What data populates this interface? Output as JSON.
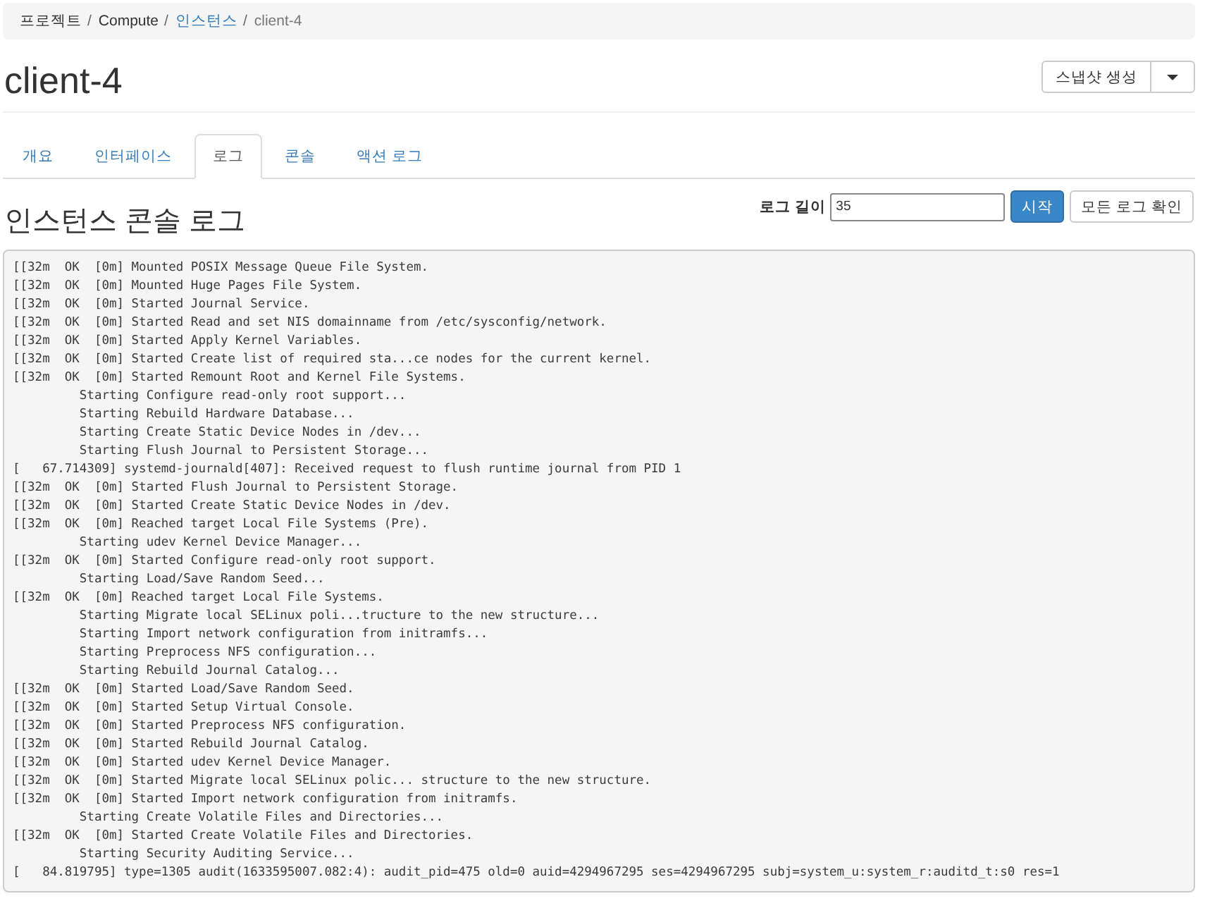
{
  "breadcrumb": [
    {
      "label": "프로젝트",
      "kind": "text",
      "separator": "/"
    },
    {
      "label": "Compute",
      "kind": "text",
      "separator": "/"
    },
    {
      "label": "인스턴스",
      "kind": "link",
      "separator": "/"
    },
    {
      "label": "client-4",
      "kind": "current"
    }
  ],
  "page_title": "client-4",
  "snapshot_button": {
    "label": "스냅샷 생성"
  },
  "tabs": [
    {
      "label": "개요",
      "selected": false
    },
    {
      "label": "인터페이스",
      "selected": false
    },
    {
      "label": "로그",
      "selected": true
    },
    {
      "label": "콘솔",
      "selected": false
    },
    {
      "label": "액션 로그",
      "selected": false
    }
  ],
  "section_title": "인스턴스 콘솔 로그",
  "log_controls": {
    "label": "로그 길이",
    "value": "35",
    "buttons": [
      {
        "label": "시작",
        "kind": "primary"
      },
      {
        "label": "모든 로그 확인",
        "kind": "default"
      }
    ]
  },
  "console_log": {
    "lines": [
      "[[32m  OK  [0m] Mounted POSIX Message Queue File System.",
      "[[32m  OK  [0m] Mounted Huge Pages File System.",
      "[[32m  OK  [0m] Started Journal Service.",
      "[[32m  OK  [0m] Started Read and set NIS domainname from /etc/sysconfig/network.",
      "[[32m  OK  [0m] Started Apply Kernel Variables.",
      "[[32m  OK  [0m] Started Create list of required sta...ce nodes for the current kernel.",
      "[[32m  OK  [0m] Started Remount Root and Kernel File Systems.",
      "         Starting Configure read-only root support...",
      "         Starting Rebuild Hardware Database...",
      "         Starting Create Static Device Nodes in /dev...",
      "         Starting Flush Journal to Persistent Storage...",
      "[   67.714309] systemd-journald[407]: Received request to flush runtime journal from PID 1",
      "[[32m  OK  [0m] Started Flush Journal to Persistent Storage.",
      "[[32m  OK  [0m] Started Create Static Device Nodes in /dev.",
      "[[32m  OK  [0m] Reached target Local File Systems (Pre).",
      "         Starting udev Kernel Device Manager...",
      "[[32m  OK  [0m] Started Configure read-only root support.",
      "         Starting Load/Save Random Seed...",
      "[[32m  OK  [0m] Reached target Local File Systems.",
      "         Starting Migrate local SELinux poli...tructure to the new structure...",
      "         Starting Import network configuration from initramfs...",
      "         Starting Preprocess NFS configuration...",
      "         Starting Rebuild Journal Catalog...",
      "[[32m  OK  [0m] Started Load/Save Random Seed.",
      "[[32m  OK  [0m] Started Setup Virtual Console.",
      "[[32m  OK  [0m] Started Preprocess NFS configuration.",
      "[[32m  OK  [0m] Started Rebuild Journal Catalog.",
      "[[32m  OK  [0m] Started udev Kernel Device Manager.",
      "[[32m  OK  [0m] Started Migrate local SELinux polic... structure to the new structure.",
      "[[32m  OK  [0m] Started Import network configuration from initramfs.",
      "         Starting Create Volatile Files and Directories...",
      "[[32m  OK  [0m] Started Create Volatile Files and Directories.",
      "         Starting Security Auditing Service...",
      "[   84.819795] type=1305 audit(1633595007.082:4): audit_pid=475 old=0 auid=4294967295 ses=4294967295 subj=system_u:system_r:auditd_t:s0 res=1"
    ]
  }
}
